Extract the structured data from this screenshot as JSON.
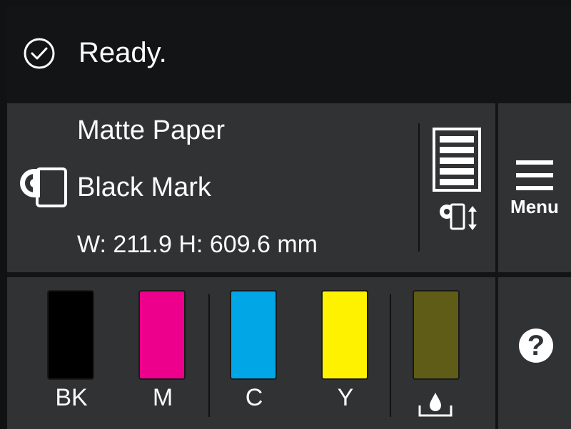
{
  "status": {
    "icon": "check-circle-icon",
    "text": "Ready."
  },
  "paper": {
    "icon": "paper-roll-icon",
    "type": "Matte Paper",
    "mark": "Black Mark",
    "size": "W: 211.9 H: 609.6 mm",
    "layout_icon": "print-layout-icon",
    "adjust_icon": "roll-feed-adjust-icon"
  },
  "menu": {
    "icon": "hamburger-menu-icon",
    "label": "Menu"
  },
  "inks": [
    {
      "label": "BK",
      "color": "#000000",
      "level": 1.0
    },
    {
      "label": "M",
      "color": "#ec008c",
      "level": 1.0
    },
    {
      "label": "C",
      "color": "#00a6e6",
      "level": 1.0
    },
    {
      "label": "Y",
      "color": "#fff200",
      "level": 1.0
    },
    {
      "label": "",
      "color": "#5f5c17",
      "level": 1.0,
      "icon": "maintenance-box-icon"
    }
  ],
  "help": {
    "icon": "question-mark-icon",
    "label": "?"
  },
  "colors": {
    "background": "#131415",
    "panel": "#303234",
    "text": "#fbfbfb"
  }
}
